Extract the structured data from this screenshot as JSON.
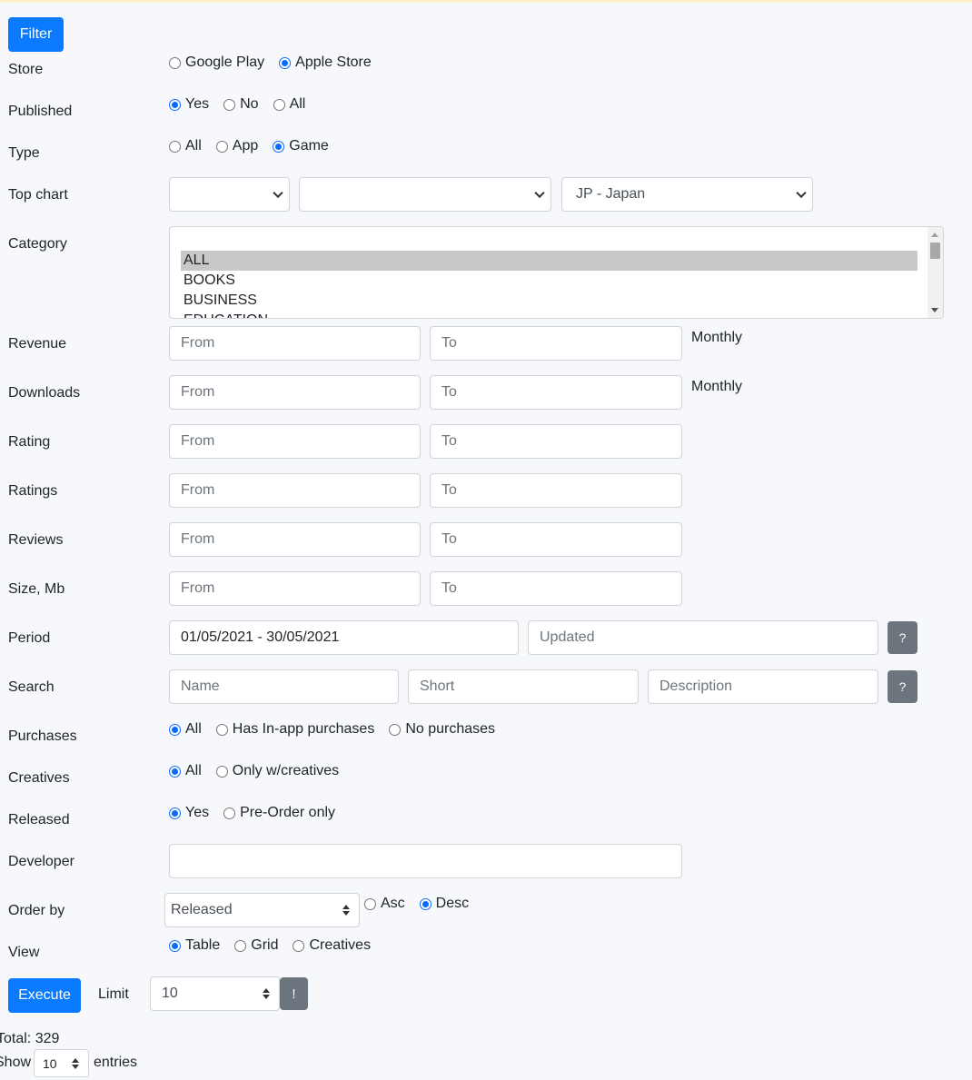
{
  "filter_button": "Filter",
  "labels": {
    "store": "Store",
    "published": "Published",
    "type": "Type",
    "top_chart": "Top chart",
    "category": "Category",
    "revenue": "Revenue",
    "downloads": "Downloads",
    "rating": "Rating",
    "ratings": "Ratings",
    "reviews": "Reviews",
    "size": "Size, Mb",
    "period": "Period",
    "search": "Search",
    "purchases": "Purchases",
    "creatives": "Creatives",
    "released": "Released",
    "developer": "Developer",
    "order_by": "Order by",
    "view": "View"
  },
  "store": {
    "options": [
      "Google Play",
      "Apple Store"
    ],
    "selected": "Apple Store"
  },
  "published": {
    "options": [
      "Yes",
      "No",
      "All"
    ],
    "selected": "Yes"
  },
  "type": {
    "options": [
      "All",
      "App",
      "Game"
    ],
    "selected": "Game"
  },
  "top_chart": {
    "select1": "",
    "select2": "",
    "country": "JP - Japan"
  },
  "category": {
    "items": [
      "ALL",
      "BOOKS",
      "BUSINESS",
      "EDUCATION"
    ],
    "selected": "ALL"
  },
  "range": {
    "from_placeholder": "From",
    "to_placeholder": "To",
    "monthly": "Monthly"
  },
  "period": {
    "value": "01/05/2021 - 30/05/2021",
    "updated_placeholder": "Updated",
    "help": "?"
  },
  "search": {
    "name_placeholder": "Name",
    "short_placeholder": "Short",
    "description_placeholder": "Description",
    "help": "?"
  },
  "purchases": {
    "options": [
      "All",
      "Has In-app purchases",
      "No purchases"
    ],
    "selected": "All"
  },
  "creatives": {
    "options": [
      "All",
      "Only w/creatives"
    ],
    "selected": "All"
  },
  "released": {
    "options": [
      "Yes",
      "Pre-Order only"
    ],
    "selected": "Yes"
  },
  "developer": {
    "value": ""
  },
  "order_by": {
    "value": "Released",
    "options": [
      "Asc",
      "Desc"
    ],
    "selected": "Desc"
  },
  "view": {
    "options": [
      "Table",
      "Grid",
      "Creatives"
    ],
    "selected": "Table"
  },
  "execute": {
    "label": "Execute",
    "limit_label": "Limit",
    "limit_value": "10",
    "bang": "!"
  },
  "footer": {
    "total": "Total: 329",
    "show": "Show",
    "show_value": "10",
    "entries": "entries"
  }
}
